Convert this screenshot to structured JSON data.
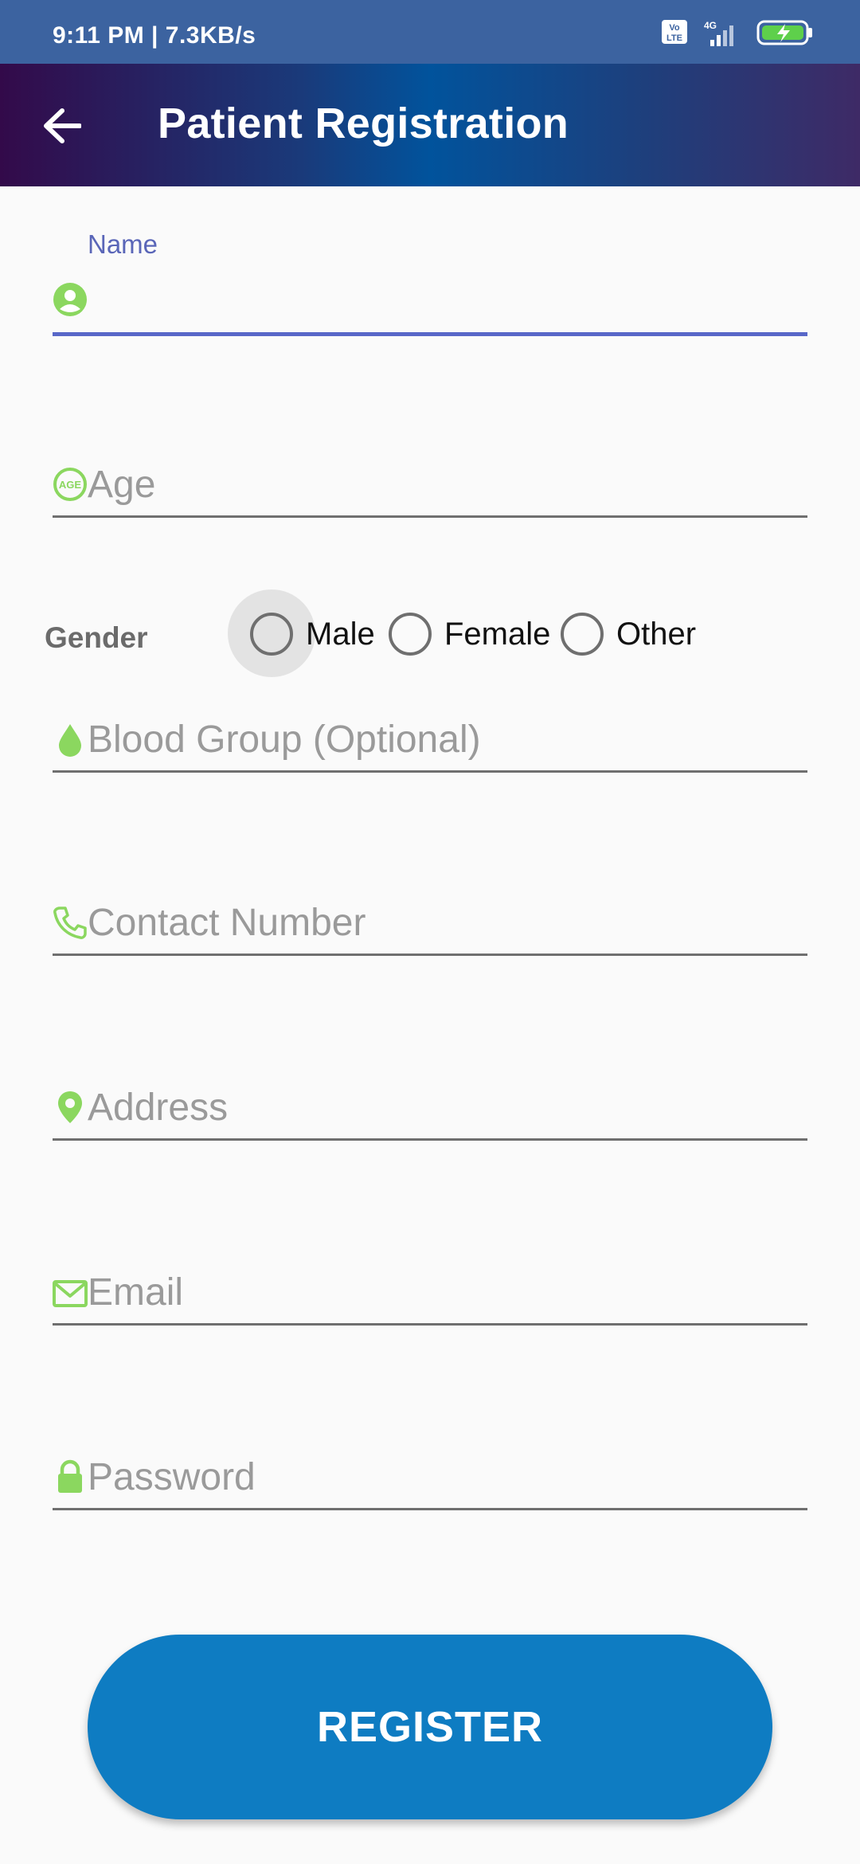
{
  "status_bar": {
    "time_speed": "9:11 PM | 7.3KB/s",
    "network_badge": "VoLTE",
    "network_type": "4G"
  },
  "app_bar": {
    "title": "Patient Registration"
  },
  "form": {
    "name": {
      "label": "Name",
      "value": ""
    },
    "age": {
      "placeholder": "Age"
    },
    "gender": {
      "label": "Gender",
      "options": [
        "Male",
        "Female",
        "Other"
      ]
    },
    "blood_group": {
      "placeholder": "Blood Group (Optional)"
    },
    "contact": {
      "placeholder": "Contact Number"
    },
    "address": {
      "placeholder": "Address"
    },
    "email": {
      "placeholder": "Email"
    },
    "password": {
      "placeholder": "Password"
    },
    "register_label": "REGISTER"
  },
  "colors": {
    "icon_green": "#8bd75f",
    "accent": "#5867c8",
    "button": "#0e7cc2"
  }
}
